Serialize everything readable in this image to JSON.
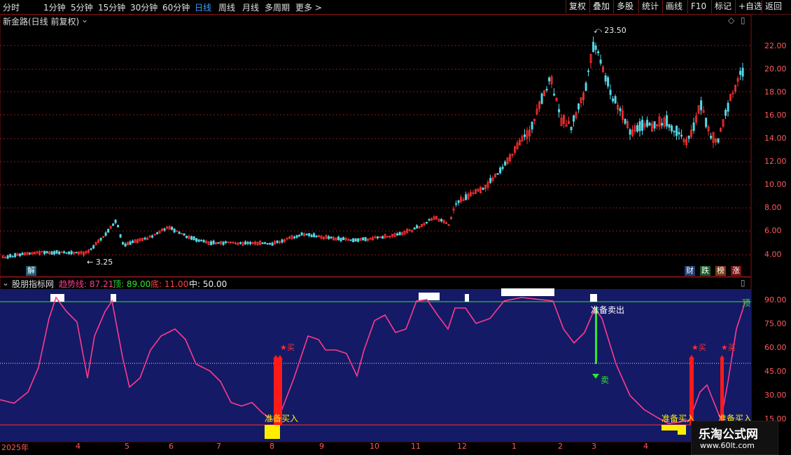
{
  "toolbar": {
    "periods": [
      "分时",
      "1分钟",
      "5分钟",
      "15分钟",
      "30分钟",
      "60分钟",
      "日线",
      "周线",
      "月线",
      "多周期",
      "更多 >"
    ],
    "active_period": "日线",
    "right_buttons": [
      "复权",
      "叠加",
      "多股",
      "统计",
      "画线",
      "F10",
      "标记",
      "+自选",
      "返回"
    ]
  },
  "price_panel": {
    "title": "新金路(日线 前复权)",
    "high_label": "23.50",
    "low_label": "3.25",
    "axis_ticks": [
      "22.00",
      "20.00",
      "18.00",
      "16.00",
      "14.00",
      "12.00",
      "10.00",
      "8.00",
      "6.00",
      "4.00"
    ],
    "tags": {
      "jie": "解",
      "cai": "财",
      "die": "跌",
      "bang": "榜",
      "zhang": "涨"
    },
    "colors": {
      "up": "#ff3030",
      "down": "#54d7e6"
    }
  },
  "indicator_panel": {
    "name": "股朋指标网",
    "trend_label": "趋势线:",
    "trend_value": "87.21",
    "top_label": "顶:",
    "top_value": "89.00",
    "bottom_label": "底:",
    "bottom_value": "11.00",
    "mid_label": "中:",
    "mid_value": "50.00",
    "axis_ticks": [
      "90.00",
      "75.00",
      "60.00",
      "45.00",
      "30.00",
      "15.00"
    ],
    "top_line_label": "顶",
    "annotations": {
      "prepare_buy": "准备买入",
      "prepare_sell": "准备卖出",
      "buy": "★买",
      "sell": "卖"
    }
  },
  "x_axis": {
    "months": [
      "2025年",
      "4",
      "5",
      "6",
      "7",
      "8",
      "9",
      "10",
      "11",
      "12",
      "1",
      "2",
      "3",
      "4"
    ]
  },
  "watermark": {
    "title": "乐淘公式网",
    "url": "www.60lt.com"
  }
}
